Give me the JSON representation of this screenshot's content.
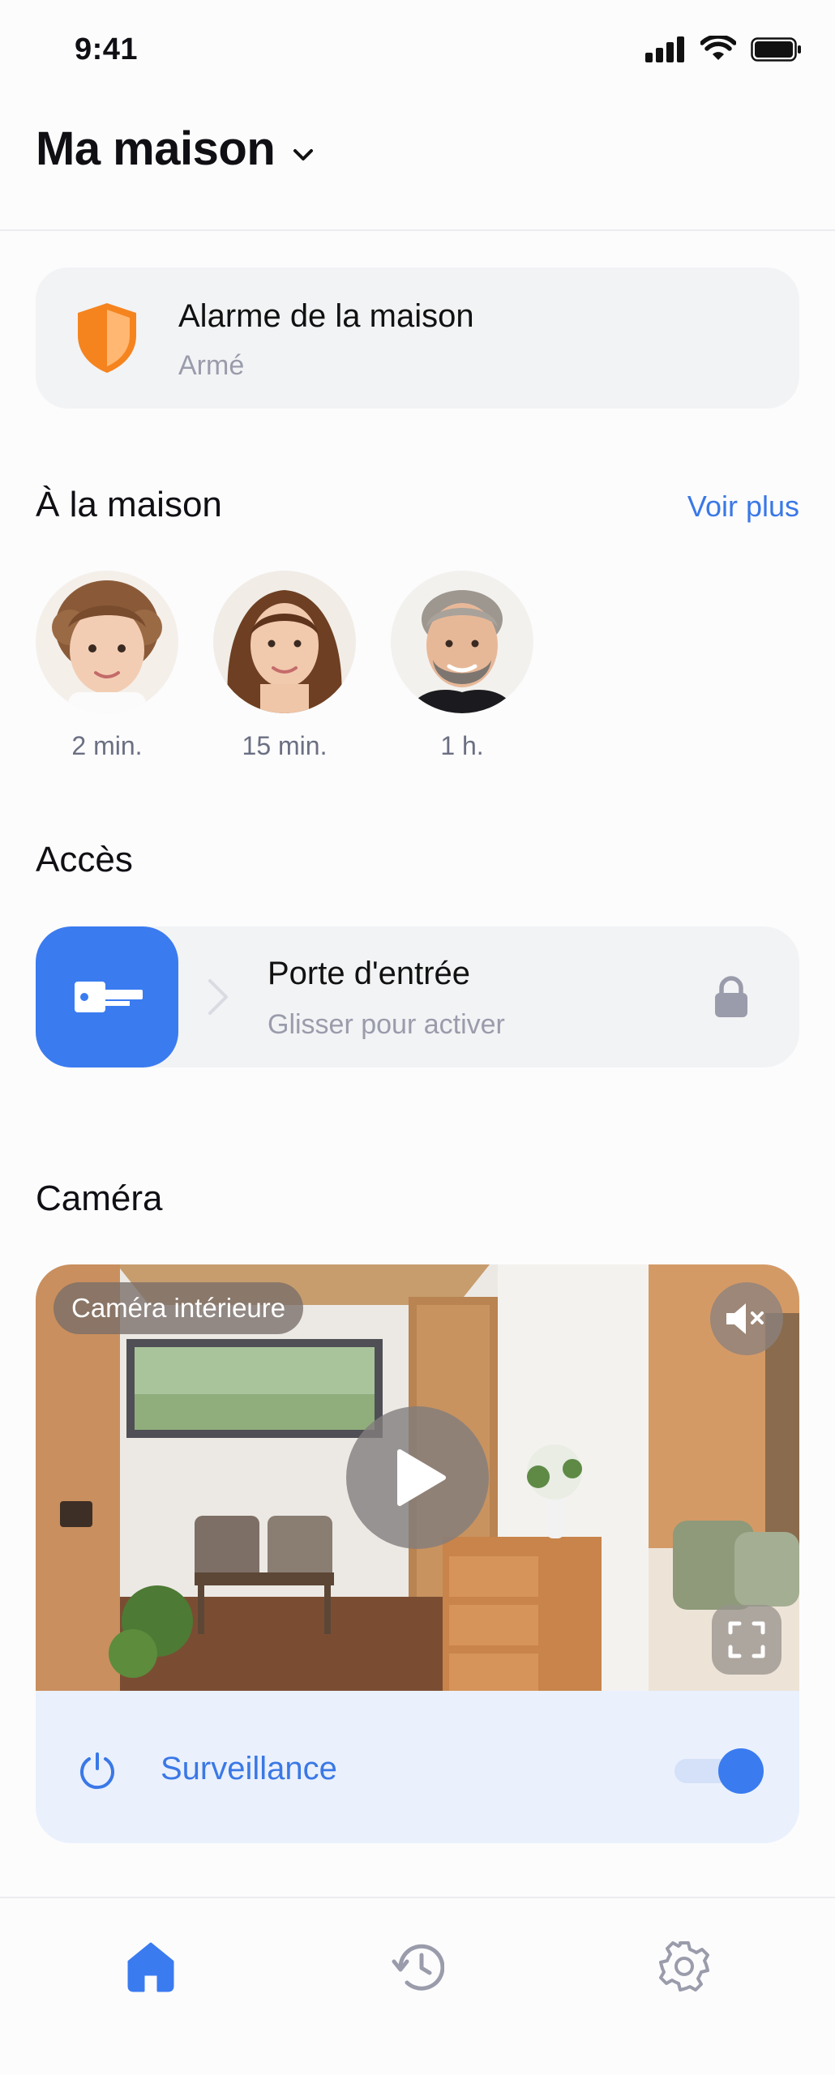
{
  "status_bar": {
    "time": "9:41"
  },
  "header": {
    "title": "Ma maison"
  },
  "alarm": {
    "title": "Alarme de la maison",
    "status": "Armé",
    "shield_color": "#f5841f"
  },
  "home": {
    "title": "À la maison",
    "see_more": "Voir plus",
    "people": [
      {
        "time": "2 min."
      },
      {
        "time": "15 min."
      },
      {
        "time": "1 h."
      }
    ]
  },
  "access": {
    "title": "Accès",
    "door_title": "Porte d'entrée",
    "door_hint": "Glisser pour activer"
  },
  "camera": {
    "title": "Caméra",
    "label": "Caméra intérieure",
    "surveillance_label": "Surveillance",
    "surveillance_on": true
  },
  "colors": {
    "accent": "#3a7bf0",
    "muted_text": "#9a9cab",
    "card_bg": "#f2f3f5"
  },
  "nav": {
    "items": [
      {
        "icon": "home-icon",
        "active": true
      },
      {
        "icon": "history-icon",
        "active": false
      },
      {
        "icon": "gear-icon",
        "active": false
      }
    ]
  }
}
